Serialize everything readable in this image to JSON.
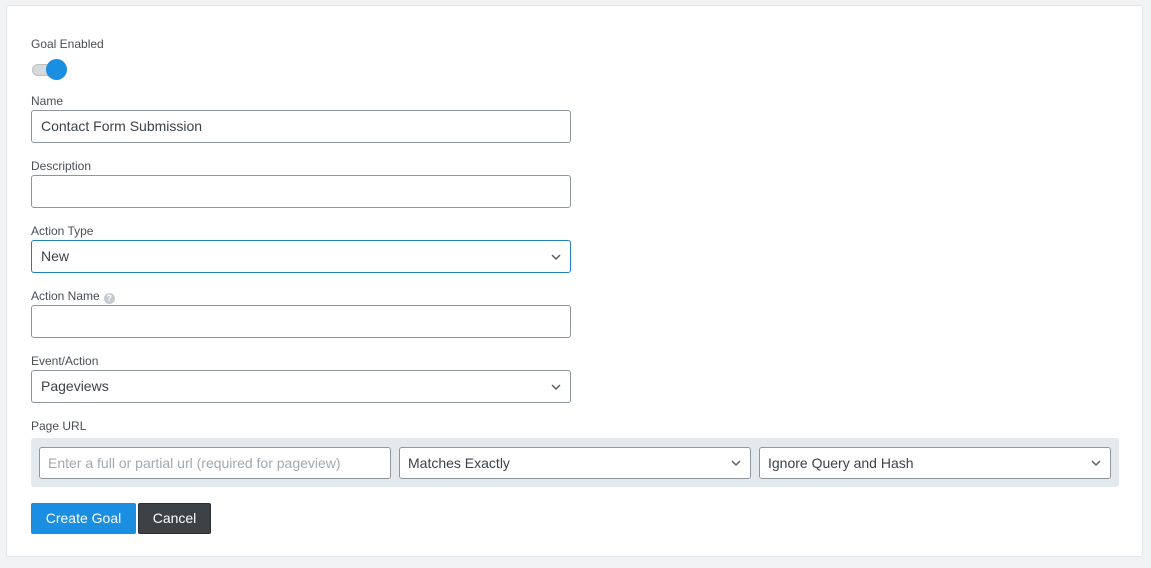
{
  "form": {
    "goal_enabled": {
      "label": "Goal Enabled",
      "value": true
    },
    "name": {
      "label": "Name",
      "value": "Contact Form Submission"
    },
    "description": {
      "label": "Description",
      "value": ""
    },
    "action_type": {
      "label": "Action Type",
      "value": "New"
    },
    "action_name": {
      "label": "Action Name",
      "help_icon": "question-circle-icon",
      "help_glyph": "?",
      "value": ""
    },
    "event_action": {
      "label": "Event/Action",
      "value": "Pageviews"
    },
    "page_url": {
      "label": "Page URL",
      "url_placeholder": "Enter a full or partial url (required for pageview)",
      "match_type": "Matches Exactly",
      "query_option": "Ignore Query and Hash"
    }
  },
  "buttons": {
    "create": "Create Goal",
    "cancel": "Cancel"
  },
  "colors": {
    "accent": "#1a8ee1",
    "cancel_bg": "#3c4246",
    "focus_border": "#1f7ec4",
    "url_row_bg": "#e4e9ed"
  }
}
